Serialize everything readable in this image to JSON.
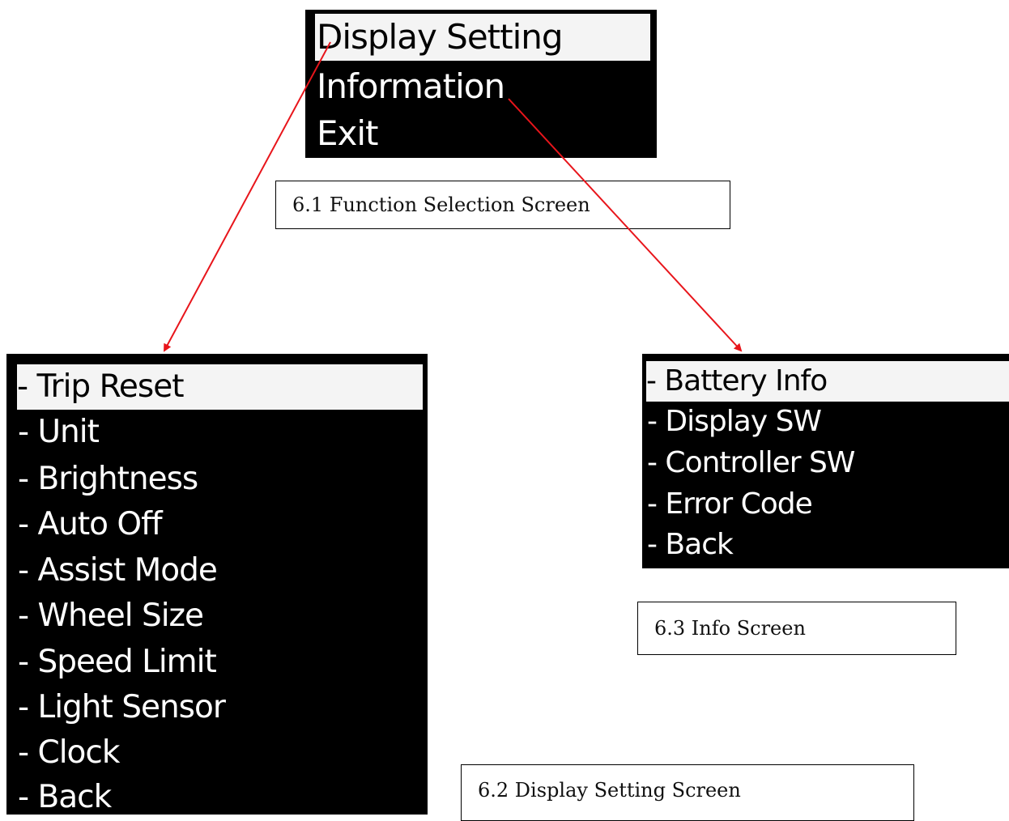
{
  "function_screen": {
    "items": [
      {
        "label": "Display Setting",
        "selected": true
      },
      {
        "label": "Information",
        "selected": false
      },
      {
        "label": "Exit",
        "selected": false
      }
    ]
  },
  "display_setting_screen": {
    "items": [
      {
        "label": "- Trip Reset",
        "selected": true
      },
      {
        "label": "- Unit",
        "selected": false
      },
      {
        "label": "- Brightness",
        "selected": false
      },
      {
        "label": "- Auto Off",
        "selected": false
      },
      {
        "label": "- Assist Mode",
        "selected": false
      },
      {
        "label": "- Wheel Size",
        "selected": false
      },
      {
        "label": "- Speed Limit",
        "selected": false
      },
      {
        "label": "- Light Sensor",
        "selected": false
      },
      {
        "label": "- Clock",
        "selected": false
      },
      {
        "label": "- Back",
        "selected": false
      }
    ]
  },
  "info_screen": {
    "items": [
      {
        "label": "- Battery Info",
        "selected": true
      },
      {
        "label": "- Display SW",
        "selected": false
      },
      {
        "label": "- Controller SW",
        "selected": false
      },
      {
        "label": "- Error Code",
        "selected": false
      },
      {
        "label": "- Back",
        "selected": false
      }
    ]
  },
  "captions": {
    "function_selection": "6.1 Function Selection Screen",
    "info": "6.3 Info Screen",
    "display_setting": "6.2 Display Setting Screen"
  },
  "colors": {
    "screen_background": "#000000",
    "menu_text": "#ffffff",
    "selected_background": "#f4f4f4",
    "selected_text": "#000000",
    "arrow": "#e8151b"
  }
}
